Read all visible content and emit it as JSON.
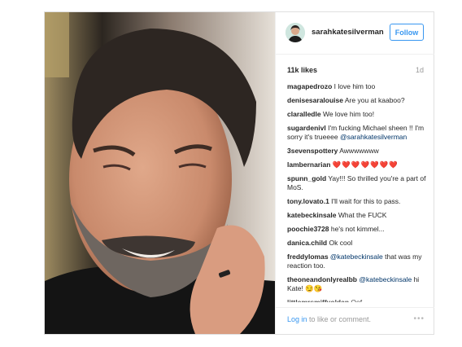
{
  "post": {
    "username": "sarahkatesilverman",
    "follow_label": "Follow",
    "likes": "11k likes",
    "time_ago": "1d",
    "comments": [
      {
        "user": "magapedrozo",
        "segments": [
          {
            "t": "I love him too",
            "m": false
          }
        ]
      },
      {
        "user": "denisesaralouise",
        "segments": [
          {
            "t": "Are you at kaaboo?",
            "m": false
          }
        ]
      },
      {
        "user": "claralledle",
        "segments": [
          {
            "t": "We love him too!",
            "m": false
          }
        ]
      },
      {
        "user": "sugardenivl",
        "segments": [
          {
            "t": "I'm fucking Michael sheen !! I'm sorry it's trueeee ",
            "m": false
          },
          {
            "t": "@sarahkatesilverman",
            "m": true
          }
        ]
      },
      {
        "user": "3sevenspottery",
        "segments": [
          {
            "t": "Awwwwwww",
            "m": false
          }
        ]
      },
      {
        "user": "lambernarian",
        "segments": [
          {
            "t": "❤️❤️❤️❤️❤️❤️❤️",
            "m": false,
            "h": true
          }
        ]
      },
      {
        "user": "spunn_gold",
        "segments": [
          {
            "t": "Yay!!! So thrilled you're a part of MoS.",
            "m": false
          }
        ]
      },
      {
        "user": "tony.lovato.1",
        "segments": [
          {
            "t": "I'll wait for this to pass.",
            "m": false
          }
        ]
      },
      {
        "user": "katebeckinsale",
        "segments": [
          {
            "t": "What the FUCK",
            "m": false
          }
        ]
      },
      {
        "user": "poochie3728",
        "segments": [
          {
            "t": "he's not kimmel...",
            "m": false
          }
        ]
      },
      {
        "user": "danica.child",
        "segments": [
          {
            "t": "Ok cool",
            "m": false
          }
        ]
      },
      {
        "user": "freddylomas",
        "segments": [
          {
            "t": "@katebeckinsale",
            "m": true
          },
          {
            "t": " that was my reaction too.",
            "m": false
          }
        ]
      },
      {
        "user": "theoneandonlyrealbb",
        "segments": [
          {
            "t": "@katebeckinsale",
            "m": true
          },
          {
            "t": " hi Kate! 😏😘",
            "m": false
          }
        ]
      },
      {
        "user": "littlemrsmiffyoldan",
        "segments": [
          {
            "t": "Oof",
            "m": false
          }
        ],
        "partial": true
      }
    ]
  },
  "footer": {
    "login_link": "Log in",
    "login_text": " to like or comment.",
    "more_icon": "•••"
  },
  "colors": {
    "accent": "#3897f0",
    "mention": "#003569",
    "heart": "#ed4956"
  }
}
